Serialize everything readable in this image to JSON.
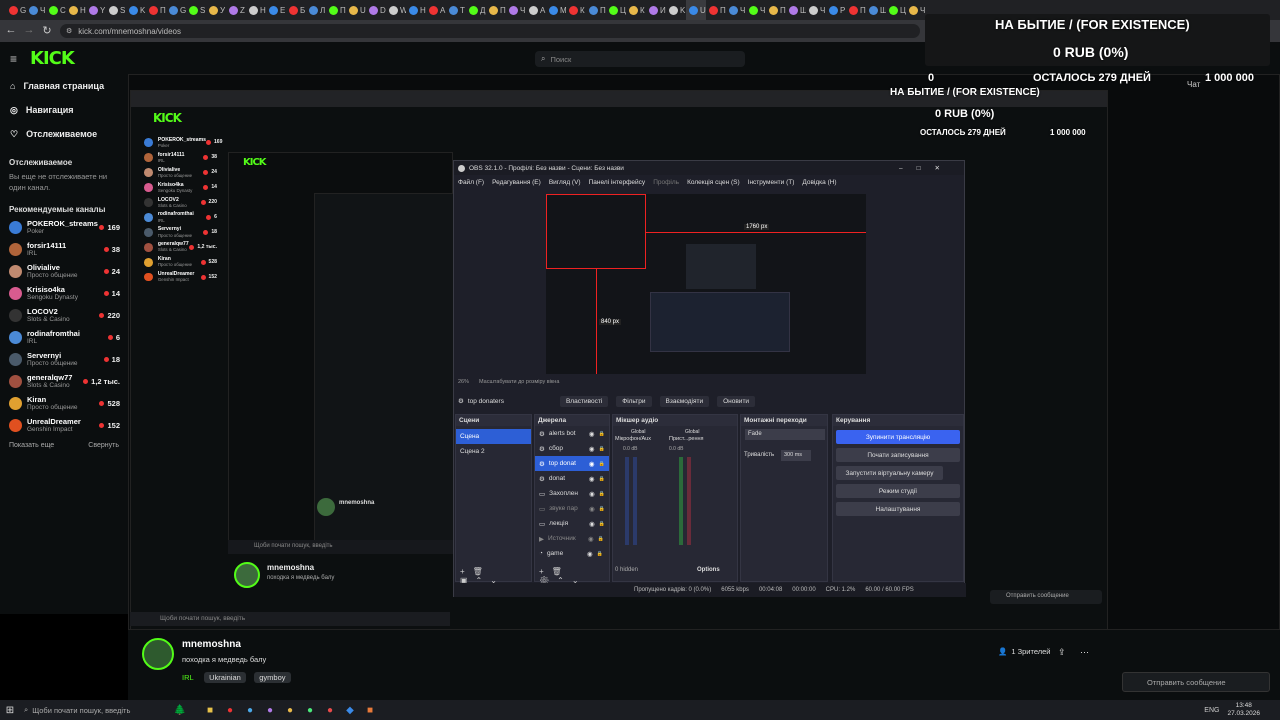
{
  "browser": {
    "url": "kick.com/mnemoshna/videos",
    "tabs": [
      "G",
      "Ч",
      "С",
      "Н",
      "Y",
      "S",
      "K",
      "П",
      "G",
      "S",
      "У",
      "Z",
      "Н",
      "E",
      "Б",
      "Л",
      "П",
      "U",
      "D",
      "W",
      "Н",
      "A",
      "Т",
      "Д",
      "П",
      "Ч",
      "А",
      "M",
      "К",
      "П",
      "Ц",
      "К",
      "И",
      "K",
      "U",
      "П",
      "Ч",
      "Ч",
      "П",
      "Ш",
      "Ч",
      "Р",
      "П",
      "Ш",
      "Ц",
      "Ч"
    ]
  },
  "kick": {
    "logo": "KICK",
    "search_placeholder": "Поиск",
    "nav": [
      {
        "icon": "home-icon",
        "label": "Главная страница"
      },
      {
        "icon": "compass-icon",
        "label": "Навигация"
      },
      {
        "icon": "heart-icon",
        "label": "Отслеживаемое"
      }
    ],
    "following_heading": "Отслеживаемое",
    "following_empty": "Вы еще не отслеживаете ни один канал.",
    "recommended_heading": "Рекомендуемые каналы",
    "channels": [
      {
        "name": "POKEROK_streams",
        "category": "Poker",
        "viewers": "169",
        "color": "#3a7bd5"
      },
      {
        "name": "forsir14111",
        "category": "IRL",
        "viewers": "38",
        "color": "#b0643a"
      },
      {
        "name": "Olivialive",
        "category": "Просто общение",
        "viewers": "24",
        "color": "#c08a70"
      },
      {
        "name": "Krisiso4ka",
        "category": "Sengoku Dynasty",
        "viewers": "14",
        "color": "#d85b8f"
      },
      {
        "name": "LOCOV2",
        "category": "Slots & Casino",
        "viewers": "220",
        "color": "#333"
      },
      {
        "name": "rodinafromthai",
        "category": "IRL",
        "viewers": "6",
        "color": "#4b8ad6"
      },
      {
        "name": "Servernyi",
        "category": "Просто общение",
        "viewers": "18",
        "color": "#4a5a6a"
      },
      {
        "name": "generalqw77",
        "category": "Slots & Casino",
        "viewers": "1,2 тыс.",
        "color": "#a05040"
      },
      {
        "name": "Kiran",
        "category": "Просто общение",
        "viewers": "528",
        "color": "#e0a030"
      },
      {
        "name": "UnrealDreamer",
        "category": "Genshin Impact",
        "viewers": "152",
        "color": "#e05020"
      }
    ],
    "show_more": "Показать еще",
    "collapse": "Свернуть"
  },
  "overlay": {
    "title": "НА БЫТИЕ / (FOR EXISTENCE)",
    "amount": "0 RUB (0%)",
    "zero": "0",
    "remaining": "ОСТАЛОСЬ 279 ДНЕЙ",
    "goal_prefix": "Чат",
    "goal": "1 000 000"
  },
  "obs": {
    "title": "OBS 32.1.0 - Профілі: Без назви - Сцени: Без назви",
    "menu": [
      "Файл (F)",
      "Редагування (E)",
      "Вигляд (V)",
      "Панелі інтерфейсу",
      "Профіль",
      "Колекція сцен (S)",
      "Інструменти (T)",
      "Довідка (H)"
    ],
    "preview_label_w": "1760 px",
    "preview_label_h": "840 px",
    "zoom": "26%",
    "scale_hint": "Масштабувати до розміру вікна",
    "active_source": "top donaters",
    "buttons": [
      "Властивості",
      "Фільтри",
      "Взаємодіяти",
      "Оновити"
    ],
    "scenes_h": "Сцени",
    "scenes": [
      "Сцена",
      "Сцена 2"
    ],
    "sources_h": "Джерела",
    "sources": [
      "alerts bot",
      "сбор",
      "top donat",
      "donat",
      "Захоплен",
      "звуке пар",
      "лекція",
      "Источник",
      "game"
    ],
    "mixer_h": "Мікшер аудіо",
    "mixer_ch1": "Мікрофон/Aux",
    "mixer_ch2": "Прист...рення",
    "mixer_global": "Global",
    "mixer_db": "0.0 dB",
    "mixer_hidden": "0 hidden",
    "mixer_options": "Options",
    "trans_h": "Монтажні переходи",
    "trans_fade": "Fade",
    "trans_dur_label": "Тривалість",
    "trans_dur": "300 ms",
    "controls_h": "Керування",
    "controls": [
      "Зупинити трансляцію",
      "Почати записування",
      "Запустити віртуальну камеру",
      "Режим студії",
      "Налаштування"
    ],
    "status_dropped": "Пропущено кадрів: 0 (0.0%)",
    "status_kbps": "6055 kbps",
    "status_time": "00:04:08",
    "status_rec": "00:00:00",
    "status_cpu": "CPU: 1.2%",
    "status_fps": "60.00 / 60.00 FPS"
  },
  "streamer": {
    "name": "mnemoshna",
    "title": "походка я медведь балу",
    "tags": [
      "IRL",
      "Ukrainian",
      "gymboy"
    ],
    "viewers": "1 Зрителей",
    "chat_send": "Отправить сообщение"
  },
  "taskbar": {
    "search": "Щоби почати пошук, введіть",
    "lang": "ENG",
    "time": "13:48",
    "date": "27.03.2026"
  }
}
